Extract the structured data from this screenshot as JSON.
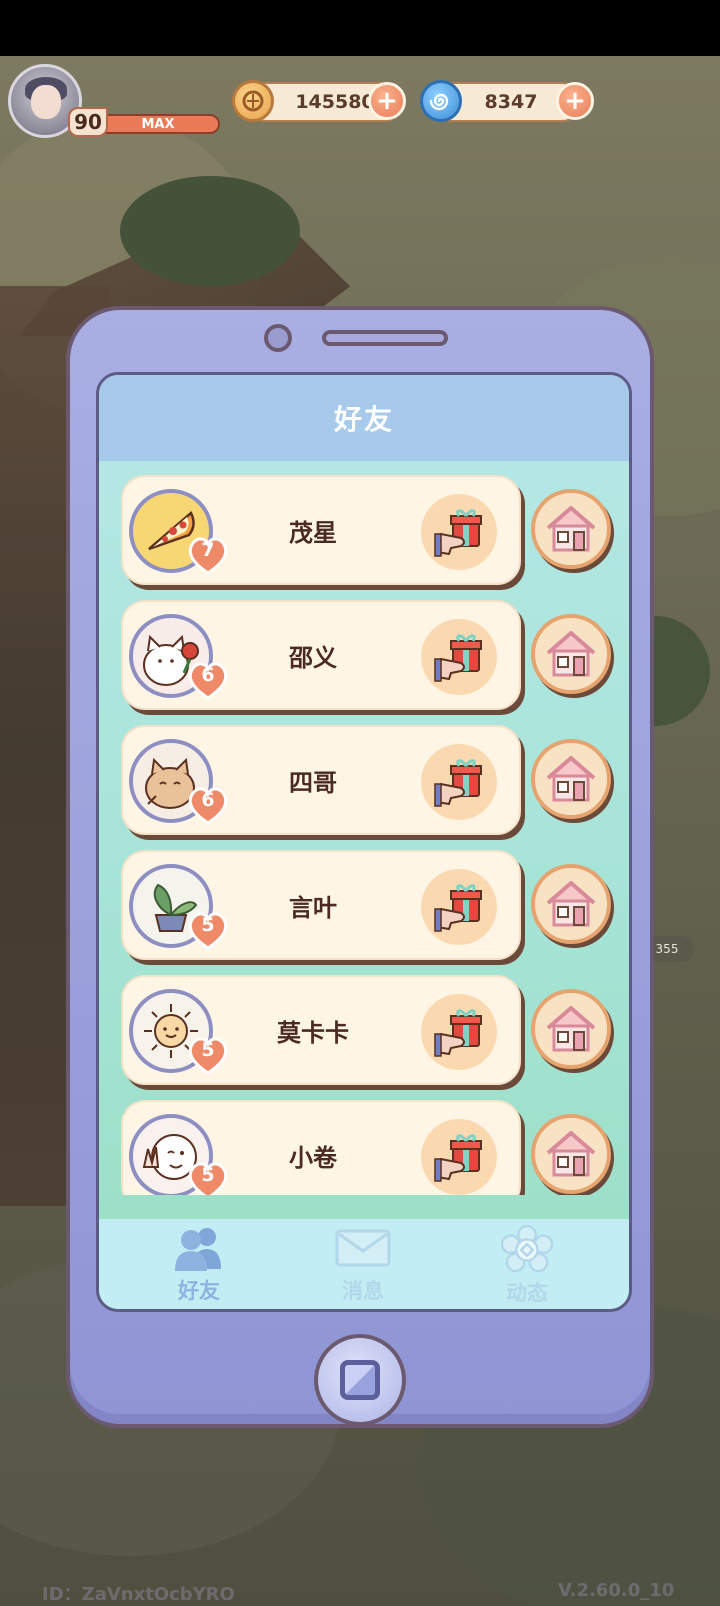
{
  "player": {
    "level": "90",
    "level_status": "MAX"
  },
  "currencies": [
    {
      "name": "coin",
      "value": "145580",
      "icon": "coin-icon",
      "color": "#f1b25c"
    },
    {
      "name": "spiral",
      "value": "8347",
      "icon": "spiral-icon",
      "color": "#4a9be0"
    }
  ],
  "panel": {
    "title": "好友"
  },
  "friends": [
    {
      "name": "茂星",
      "heart": "7",
      "avatar_icon": "pizza-icon"
    },
    {
      "name": "邵义",
      "heart": "6",
      "avatar_icon": "cat-rose-icon"
    },
    {
      "name": "四哥",
      "heart": "6",
      "avatar_icon": "cat-icon"
    },
    {
      "name": "言叶",
      "heart": "5",
      "avatar_icon": "plant-icon"
    },
    {
      "name": "莫卡卡",
      "heart": "5",
      "avatar_icon": "sun-icon"
    },
    {
      "name": "小卷",
      "heart": "5",
      "avatar_icon": "wink-face-icon"
    }
  ],
  "tabs": [
    {
      "label": "好友",
      "icon": "friends-icon"
    },
    {
      "label": "消息",
      "icon": "mail-icon"
    },
    {
      "label": "动态",
      "icon": "flower-icon"
    }
  ],
  "world": {
    "side_badge": "355"
  },
  "footer": {
    "id_text": "ID：ZaVnxtOcbYRO",
    "version": "V.2.60.0_10"
  },
  "colors": {
    "phone_body": "#9ea4dd",
    "card_bg": "#fff5e5",
    "heart": "#ee8a68",
    "tab_active": "#8fb3e0",
    "tab_inactive": "#b2d7ea"
  }
}
